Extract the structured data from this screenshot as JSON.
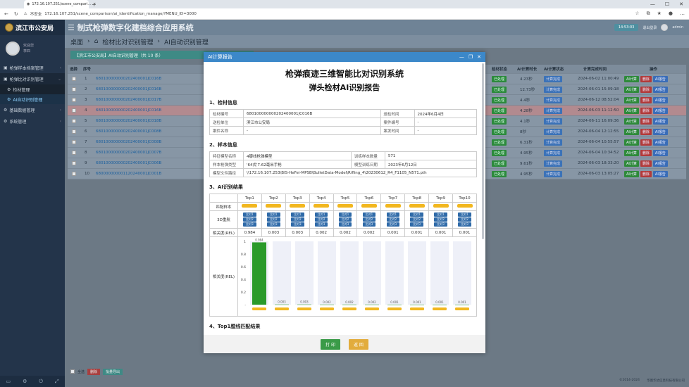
{
  "browser": {
    "tab_title": "172.16.107.251/scene_compari...",
    "insecure_label": "不安全",
    "url": "172.16.107.251/scene_comparison/ai_identification_manage/?MENU_ID=3000"
  },
  "app": {
    "org_name": "滨江市公安局",
    "system_title": "制式枪弹数字化建档综合应用系统",
    "user_greeting": "欢迎您",
    "user_name": "李四",
    "time": "14:53:03",
    "logout": "退出登录",
    "user_right": "admin"
  },
  "sidebar": {
    "items": [
      {
        "label": "枪弹样本档案管理",
        "expanded": false
      },
      {
        "label": "枪弹比对识别管理",
        "expanded": true
      },
      {
        "label": "检材管理",
        "sub": true
      },
      {
        "label": "AI自动识别管理",
        "sub": true,
        "selected": true
      },
      {
        "label": "基础数据管理",
        "expanded": false
      },
      {
        "label": "系统管理",
        "expanded": false
      }
    ]
  },
  "breadcrumb": {
    "home": "桌面",
    "mid": "检材比对识别管理",
    "current": "AI自动识别管理"
  },
  "panel_title": "【滨江市公安局】AI自动识别管理（共 10 条）",
  "table": {
    "headers": [
      "选择",
      "序号",
      "检材状态",
      "AI计算时长",
      "AI计算状态",
      "计算完成时间",
      "操作"
    ],
    "rows": [
      {
        "no": "1",
        "code": "680100000000202400001JC016B",
        "status": "已处理",
        "dur": "4.23秒",
        "state": "计算完成",
        "time": "2024-06-02 11:00:49"
      },
      {
        "no": "2",
        "code": "680100000000202400001JC016B",
        "status": "已处理",
        "dur": "12.73秒",
        "state": "计算完成",
        "time": "2024-06-01 15:09:18"
      },
      {
        "no": "3",
        "code": "680100000000202400001JC017B",
        "status": "已处理",
        "dur": "4.4秒",
        "state": "计算完成",
        "time": "2024-06-12 08:52:04"
      },
      {
        "no": "4",
        "code": "680100000000202400001JC016B",
        "status": "已处理",
        "dur": "4.28秒",
        "state": "计算完成",
        "time": "2024-06-03 11:12:50"
      },
      {
        "no": "5",
        "code": "680100000000202400001JC018B",
        "status": "已处理",
        "dur": "4.1秒",
        "state": "计算完成",
        "time": "2024-06-11 16:09:36"
      },
      {
        "no": "6",
        "code": "680100000000202400001JC008B",
        "status": "已处理",
        "dur": "8秒",
        "state": "计算完成",
        "time": "2024-06-04 12:12:55"
      },
      {
        "no": "7",
        "code": "680100000000202400001JC008B",
        "status": "已处理",
        "dur": "6.31秒",
        "state": "计算完成",
        "time": "2024-06-04 10:55:57"
      },
      {
        "no": "8",
        "code": "680100000000202400001JC007B",
        "status": "已处理",
        "dur": "4.95秒",
        "state": "计算完成",
        "time": "2024-06-04 10:34:52"
      },
      {
        "no": "9",
        "code": "680100000000202400001JC006B",
        "status": "已处理",
        "dur": "9.61秒",
        "state": "计算完成",
        "time": "2024-06-03 18:33:20"
      },
      {
        "no": "10",
        "code": "680000000001120240001JC001B",
        "status": "已处理",
        "dur": "4.95秒",
        "state": "计算完成",
        "time": "2024-06-03 13:05:27"
      }
    ],
    "op_labels": {
      "ai": "AI计算",
      "del": "删除",
      "report": "AI报告"
    }
  },
  "bottom": {
    "select_all": "全选",
    "delete": "删除",
    "export": "批量导出"
  },
  "footer": {
    "copyright": "©2014-2024",
    "company": "华图华达信息科技有限公司"
  },
  "modal": {
    "title": "AI计算报告",
    "h1": "枪弹痕迹三维智能比对识别系统",
    "h2": "弹头检材AI识别报告",
    "sec1": "1、检材信息",
    "info1": [
      [
        "检材编号",
        "680100000000202400001JC016B",
        "送检时间",
        "2024年6月4日"
      ],
      [
        "送检单位",
        "滨江市公安局",
        "案件编号",
        "-"
      ],
      [
        "案件名称",
        "-",
        "案发时间",
        "-"
      ]
    ],
    "sec2": "2、样本信息",
    "info2": [
      [
        "特征模型名称",
        "4瓣线枪弹模型",
        "训练样本数量",
        "571"
      ],
      [
        "样本枪弹类型",
        "'64式'7.62毫米手枪",
        "模型训练日期",
        "2023年6月12日"
      ]
    ],
    "model_path_label": "模型文件路径",
    "model_path": "\\\\172.16.107.253\\BIS-HeFei-MPSB\\BulletData-Model\\Rifling_4\\20230612_R4_F1105_N571.pth",
    "sec3": "3、AI识别结果",
    "tops": [
      "Top1",
      "Top2",
      "Top3",
      "Top4",
      "Top5",
      "Top6",
      "Top7",
      "Top8",
      "Top9",
      "Top10"
    ],
    "row_match": "匹配样本",
    "row_3d": "3D重航",
    "cmp_labels": [
      "比对1",
      "比对2",
      "比对3"
    ],
    "row_rel": "相关度(REL)",
    "rel_values": [
      "0.984",
      "0.003",
      "0.003",
      "0.002",
      "0.002",
      "0.002",
      "0.001",
      "0.001",
      "0.001",
      "0.001"
    ],
    "chart_label": "相关度(REL)",
    "sec4": "4、Top1膛线匹配结果",
    "print": "打 印",
    "back": "返 回"
  },
  "chart_data": {
    "type": "bar",
    "categories": [
      "Top1",
      "Top2",
      "Top3",
      "Top4",
      "Top5",
      "Top6",
      "Top7",
      "Top8",
      "Top9",
      "Top10"
    ],
    "values": [
      0.984,
      0.003,
      0.003,
      0.002,
      0.002,
      0.002,
      0.001,
      0.001,
      0.001,
      0.001
    ],
    "data_labels": [
      "0.984",
      "0.003",
      "0.003",
      "0.002",
      "0.002",
      "0.002",
      "0.001",
      "0.001",
      "0.001",
      "0.001"
    ],
    "ylabel": "相关度(REL)",
    "ylim": [
      0,
      1
    ],
    "yticks": [
      "1",
      "0.8",
      "0.6",
      "0.4",
      "0.2",
      "-"
    ],
    "bar_color": "#2a9a2a"
  }
}
